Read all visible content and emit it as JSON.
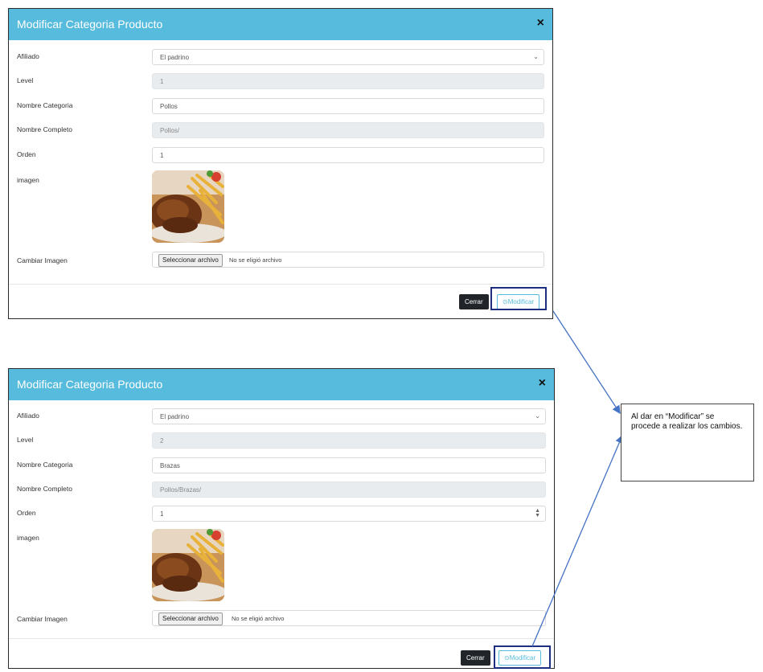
{
  "modal1": {
    "title": "Modificar Categoria Producto",
    "close_icon": "×",
    "fields": {
      "afiliado_label": "Afiliado",
      "afiliado_value": "El padrino",
      "level_label": "Level",
      "level_value": "1",
      "nombre_categoria_label": "Nombre Categoria",
      "nombre_categoria_value": "Pollos",
      "nombre_completo_label": "Nombre Completo",
      "nombre_completo_value": "Pollos/",
      "orden_label": "Orden",
      "orden_value": "1",
      "imagen_label": "imagen",
      "cambiar_imagen_label": "Cambiar Imagen",
      "file_button": "Seleccionar archivo",
      "file_status": "No se eligió archivo"
    },
    "footer": {
      "cerrar": "Cerrar",
      "modificar": "⊙Modificar"
    }
  },
  "modal2": {
    "title": "Modificar Categoria Producto",
    "close_icon": "×",
    "fields": {
      "afiliado_label": "Afiliado",
      "afiliado_value": "El padrino",
      "level_label": "Level",
      "level_value": "2",
      "nombre_categoria_label": "Nombre Categoria",
      "nombre_categoria_value": "Brazas",
      "nombre_completo_label": "Nombre Completo",
      "nombre_completo_value": "Pollos/Brazas/",
      "orden_label": "Orden",
      "orden_value": "1",
      "imagen_label": "imagen",
      "cambiar_imagen_label": "Cambiar Imagen",
      "file_button": "Seleccionar archivo",
      "file_status": "No se eligió archivo"
    },
    "footer": {
      "cerrar": "Cerrar",
      "modificar": "⊙Modificar"
    }
  },
  "callout": {
    "text": "Al dar en “Modificar” se procede a realizar los cambios."
  },
  "colors": {
    "header": "#56bbdc",
    "highlight": "#1d2f7e",
    "arrow": "#4472c4",
    "dark_button": "#212529"
  },
  "icons": {
    "select": "chevron-down-icon",
    "number": "spinner-icon",
    "close": "close-icon",
    "modify": "circle-icon"
  }
}
